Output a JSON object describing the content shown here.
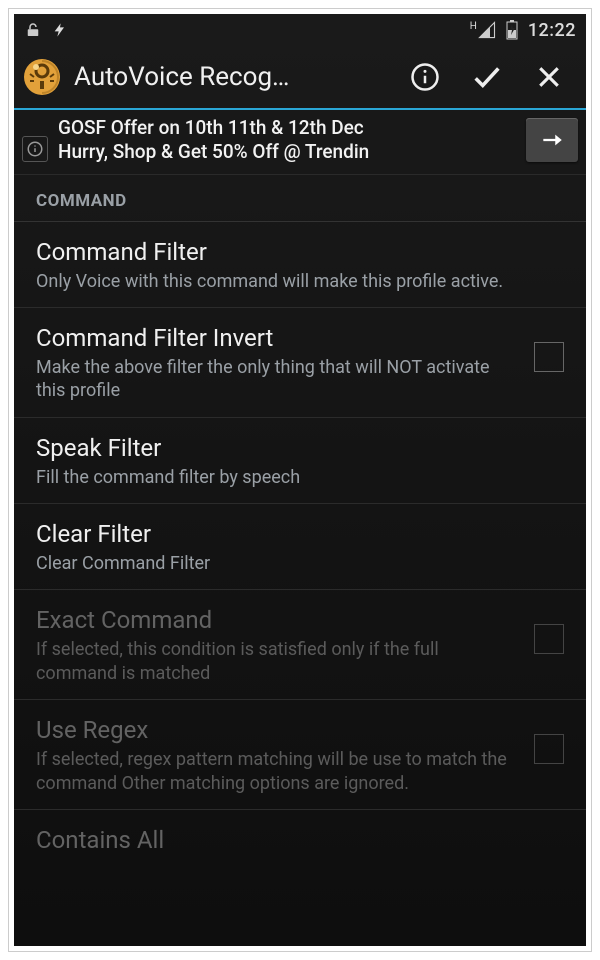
{
  "statusbar": {
    "time": "12:22",
    "signal_label": "H"
  },
  "actionbar": {
    "title": "AutoVoice Recog…"
  },
  "ad": {
    "line1": "GOSF Offer on 10th 11th & 12th Dec",
    "line2": "Hurry, Shop & Get 50% Off @ Trendin"
  },
  "section": {
    "header": "COMMAND",
    "items": [
      {
        "title": "Command Filter",
        "desc": "Only Voice with this command will make this profile active.",
        "checkbox": false,
        "disabled": false
      },
      {
        "title": "Command Filter Invert",
        "desc": "Make the above filter the only thing that will NOT activate this profile",
        "checkbox": true,
        "disabled": false
      },
      {
        "title": "Speak Filter",
        "desc": "Fill the command filter by speech",
        "checkbox": false,
        "disabled": false
      },
      {
        "title": "Clear Filter",
        "desc": "Clear Command Filter",
        "checkbox": false,
        "disabled": false
      },
      {
        "title": "Exact Command",
        "desc": "If selected, this condition is satisfied only if the full command is matched",
        "checkbox": true,
        "disabled": true
      },
      {
        "title": "Use Regex",
        "desc": "If selected, regex pattern matching will be use to match the command Other matching options are ignored.",
        "checkbox": true,
        "disabled": true
      },
      {
        "title": "Contains All",
        "desc": "",
        "checkbox": false,
        "disabled": true
      }
    ]
  }
}
